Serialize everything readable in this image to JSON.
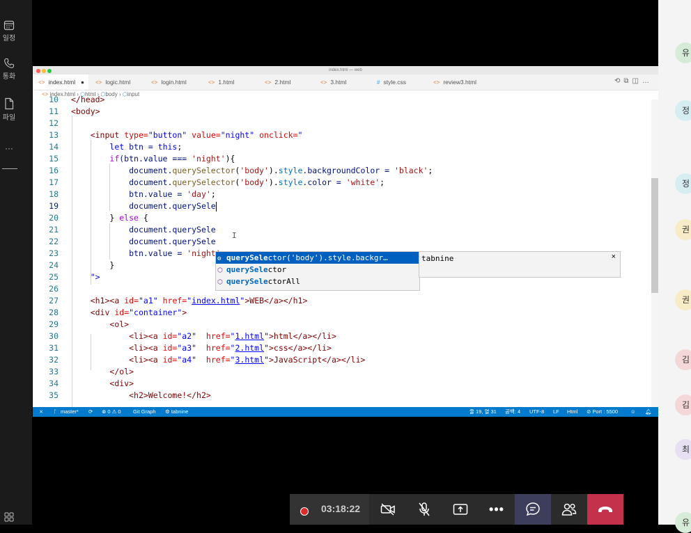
{
  "rail": {
    "items": [
      {
        "label": "일정",
        "icon": "calendar-icon"
      },
      {
        "label": "통화",
        "icon": "phone-icon"
      },
      {
        "label": "파일",
        "icon": "file-icon"
      }
    ],
    "more": "···"
  },
  "participants": [
    "유",
    "정",
    "정",
    "권",
    "권",
    "김",
    "김",
    "최",
    "유"
  ],
  "vscode": {
    "window_title": "index.html — web",
    "tabs": [
      {
        "label": "index.html",
        "icon": "<>",
        "active": true,
        "dirty": "●"
      },
      {
        "label": "logic.html",
        "icon": "<>"
      },
      {
        "label": "login.html",
        "icon": "<>"
      },
      {
        "label": "1.html",
        "icon": "<>"
      },
      {
        "label": "2.html",
        "icon": "<>"
      },
      {
        "label": "3.html",
        "icon": "<>"
      },
      {
        "label": "style.css",
        "icon": "#"
      },
      {
        "label": "review3.html",
        "icon": "<>"
      }
    ],
    "breadcrumb": [
      "index.html",
      "html",
      "body",
      "input"
    ],
    "lines": [
      "10",
      "11",
      "12",
      "13",
      "14",
      "15",
      "16",
      "17",
      "18",
      "19",
      "20",
      "21",
      "22",
      "23",
      "24",
      "25",
      "26",
      "27",
      "28",
      "29",
      "30",
      "31",
      "32",
      "33",
      "34",
      "35"
    ],
    "code": {
      "l10": "</head>",
      "l11": "<body>",
      "l13a": "<input",
      "l13b": "type=",
      "l13c": "\"button\"",
      "l13d": "value=",
      "l13e": "\"night\"",
      "l13f": "onclick=",
      "l13g": "\"",
      "l14a": "let",
      "l14b": " btn = ",
      "l14c": "this",
      "l14d": ";",
      "l15a": "if",
      "l15b": "(btn.value === ",
      "l15c": "'night'",
      "l15d": "){",
      "l16": "document.",
      "l16b": "querySelector",
      "l16c": "(",
      "l16d": "'body'",
      "l16e": ").",
      "l16f": "style",
      "l16g": ".backgroundColor = ",
      "l16h": "'black'",
      "l16i": ";",
      "l17g": ".color = ",
      "l17h": "'white'",
      "l18a": "btn.value = ",
      "l18b": "'day'",
      "l18c": ";",
      "l19": "document.querySele",
      "l20a": "} ",
      "l20b": "else",
      "l20c": " {",
      "l21": "document.querySele",
      "l22": "document.querySele",
      "l23a": "btn.value = ",
      "l23b": "'night'",
      "l23c": ";",
      "l24": "}",
      "l25": "\">",
      "l27a": "<h1><a",
      "l27b": "id=",
      "l27c": "\"a1\"",
      "l27d": "href=",
      "l27e": "\"",
      "l27f": "index.html",
      "l27g": "\"",
      "l27h": ">WEB</a></h1>",
      "l28a": "<div",
      "l28b": "id=",
      "l28c": "\"container\"",
      "l28d": ">",
      "l29": "<ol>",
      "l30a": "<li><a",
      "l30b": "id=",
      "l30c": "\"a2\"",
      "l30d": "href=",
      "l30e": "1.html",
      "l30f": ">html</a></li>",
      "l31c": "\"a3\"",
      "l31e": "2.html",
      "l31f": ">css</a></li>",
      "l32c": "\"a4\"",
      "l32e": "3.html",
      "l32f": ">JavaScript</a></li>",
      "l33": "</ol>",
      "l34": "<div>",
      "l35": "<h2>Welcome!</h2>"
    },
    "suggest": {
      "items": [
        {
          "match": "querySele",
          "rest": "ctor('body').style.backgr…",
          "icon": "wrench-icon"
        },
        {
          "match": "querySele",
          "rest": "ctor",
          "icon": "cube-icon"
        },
        {
          "match": "querySele",
          "rest": "ctorAll",
          "icon": "cube-icon"
        }
      ],
      "details": "tabnine",
      "close": "×"
    },
    "status": {
      "branch": "master*",
      "problems": "⊗ 0 ⚠ 0",
      "git_graph": "Git Graph",
      "tabnine": "tabnine",
      "position": "줄 19, 열 31",
      "spaces": "공백: 4",
      "encoding": "UTF-8",
      "eol": "LF",
      "language": "Html",
      "port": "Port : 5500"
    }
  },
  "meeting": {
    "timer": "03:18:22",
    "more": "•••",
    "colors": {
      "record": "#d92c2c",
      "hangup": "#c4314b",
      "chat": "#3d3d5c"
    }
  }
}
